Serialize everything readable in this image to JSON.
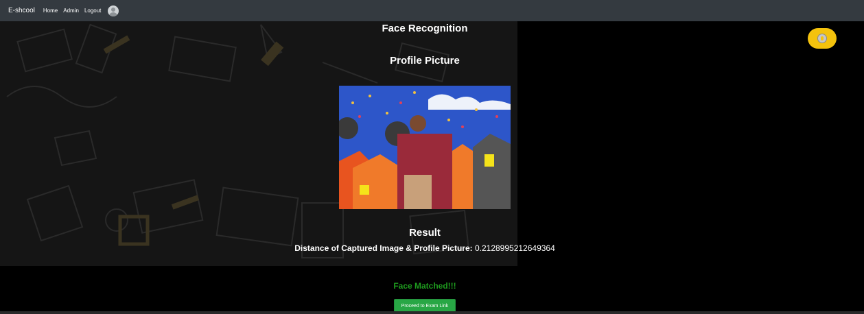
{
  "navbar": {
    "brand": "E-shcool",
    "links": [
      "Home",
      "Admin",
      "Logout"
    ],
    "avatar_icon": "user-avatar-icon"
  },
  "main": {
    "title": "Face Recognition",
    "profile_heading": "Profile Picture",
    "result_heading": "Result",
    "distance_label": "Distance of Captured Image & Profile Picture:",
    "distance_value": "0.2128995212649364",
    "match_status": "Face Matched!!!",
    "proceed_button": "Proceed to Exam Link"
  },
  "theme_toggle": {
    "icon": "theme-toggle-icon"
  },
  "colors": {
    "navbar": "#343a40",
    "success_text": "#1e9b1e",
    "button": "#28a745",
    "toggle": "#f4c20d"
  }
}
